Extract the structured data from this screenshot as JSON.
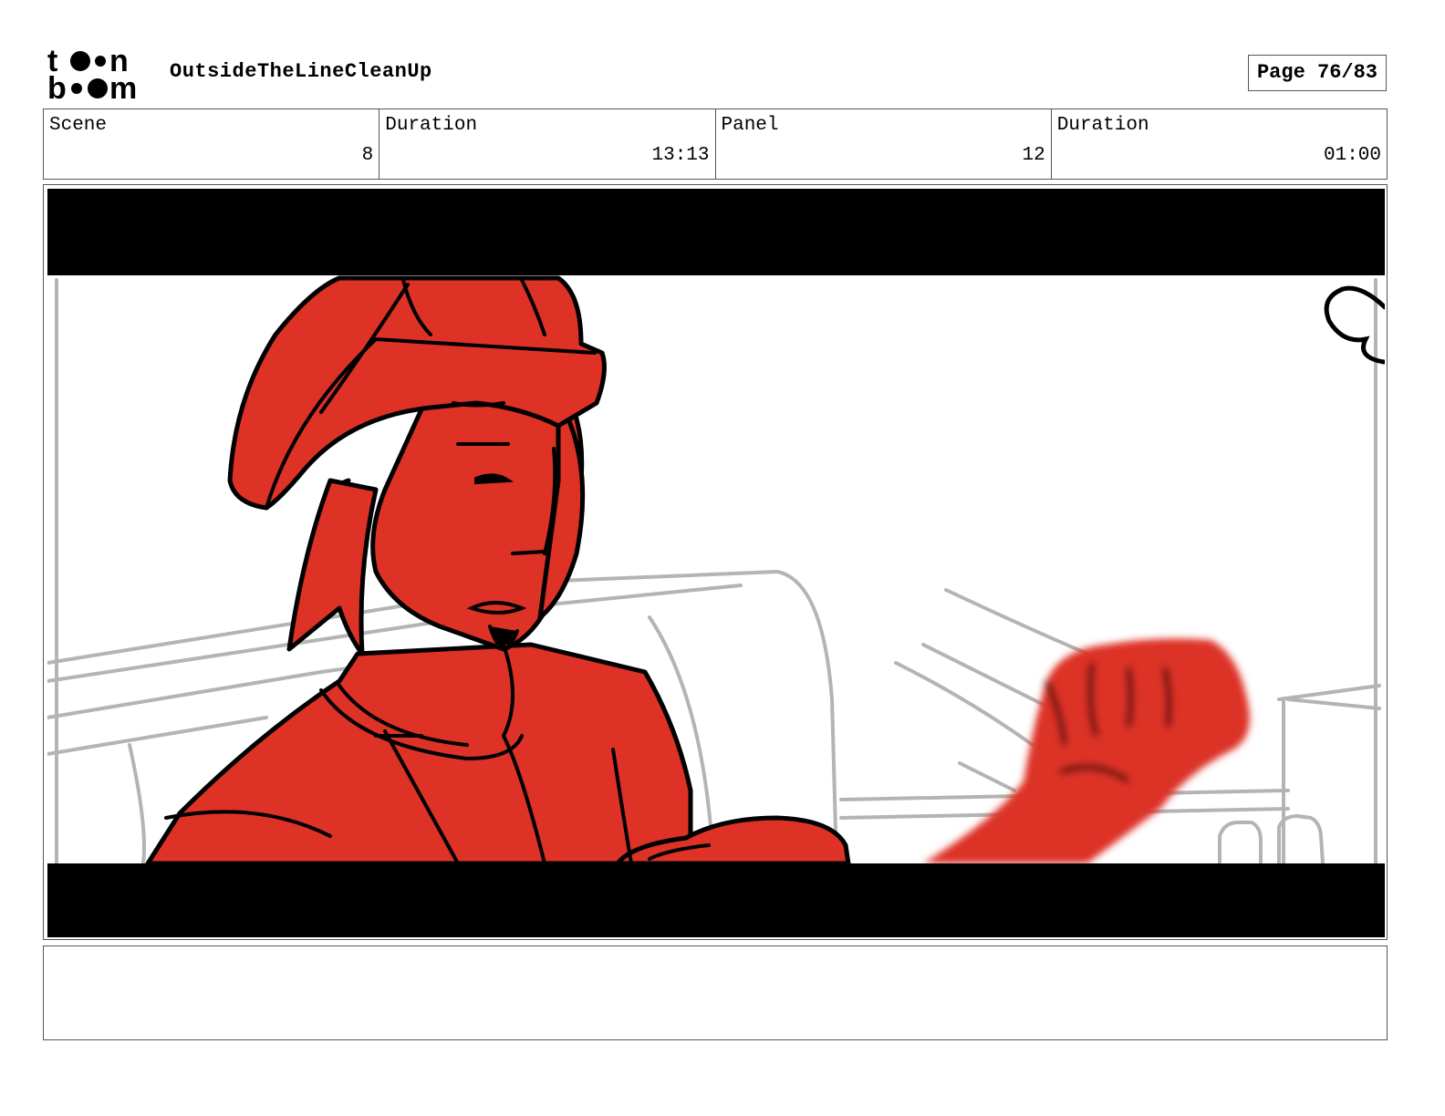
{
  "header": {
    "logo_icon": "toonboom-logo",
    "project_title": "OutsideTheLineCleanUp",
    "page_indicator": "Page 76/83"
  },
  "info_table": {
    "scene_label": "Scene",
    "scene_value": "8",
    "scene_duration_label": "Duration",
    "scene_duration_value": "13:13",
    "panel_label": "Panel",
    "panel_value": "12",
    "panel_duration_label": "Duration",
    "panel_duration_value": "01:00"
  },
  "panel": {
    "character_color": "#dd3225",
    "letterbox_color": "#000000",
    "background_line_color": "#b4b4b4"
  },
  "notes": {
    "text": ""
  }
}
